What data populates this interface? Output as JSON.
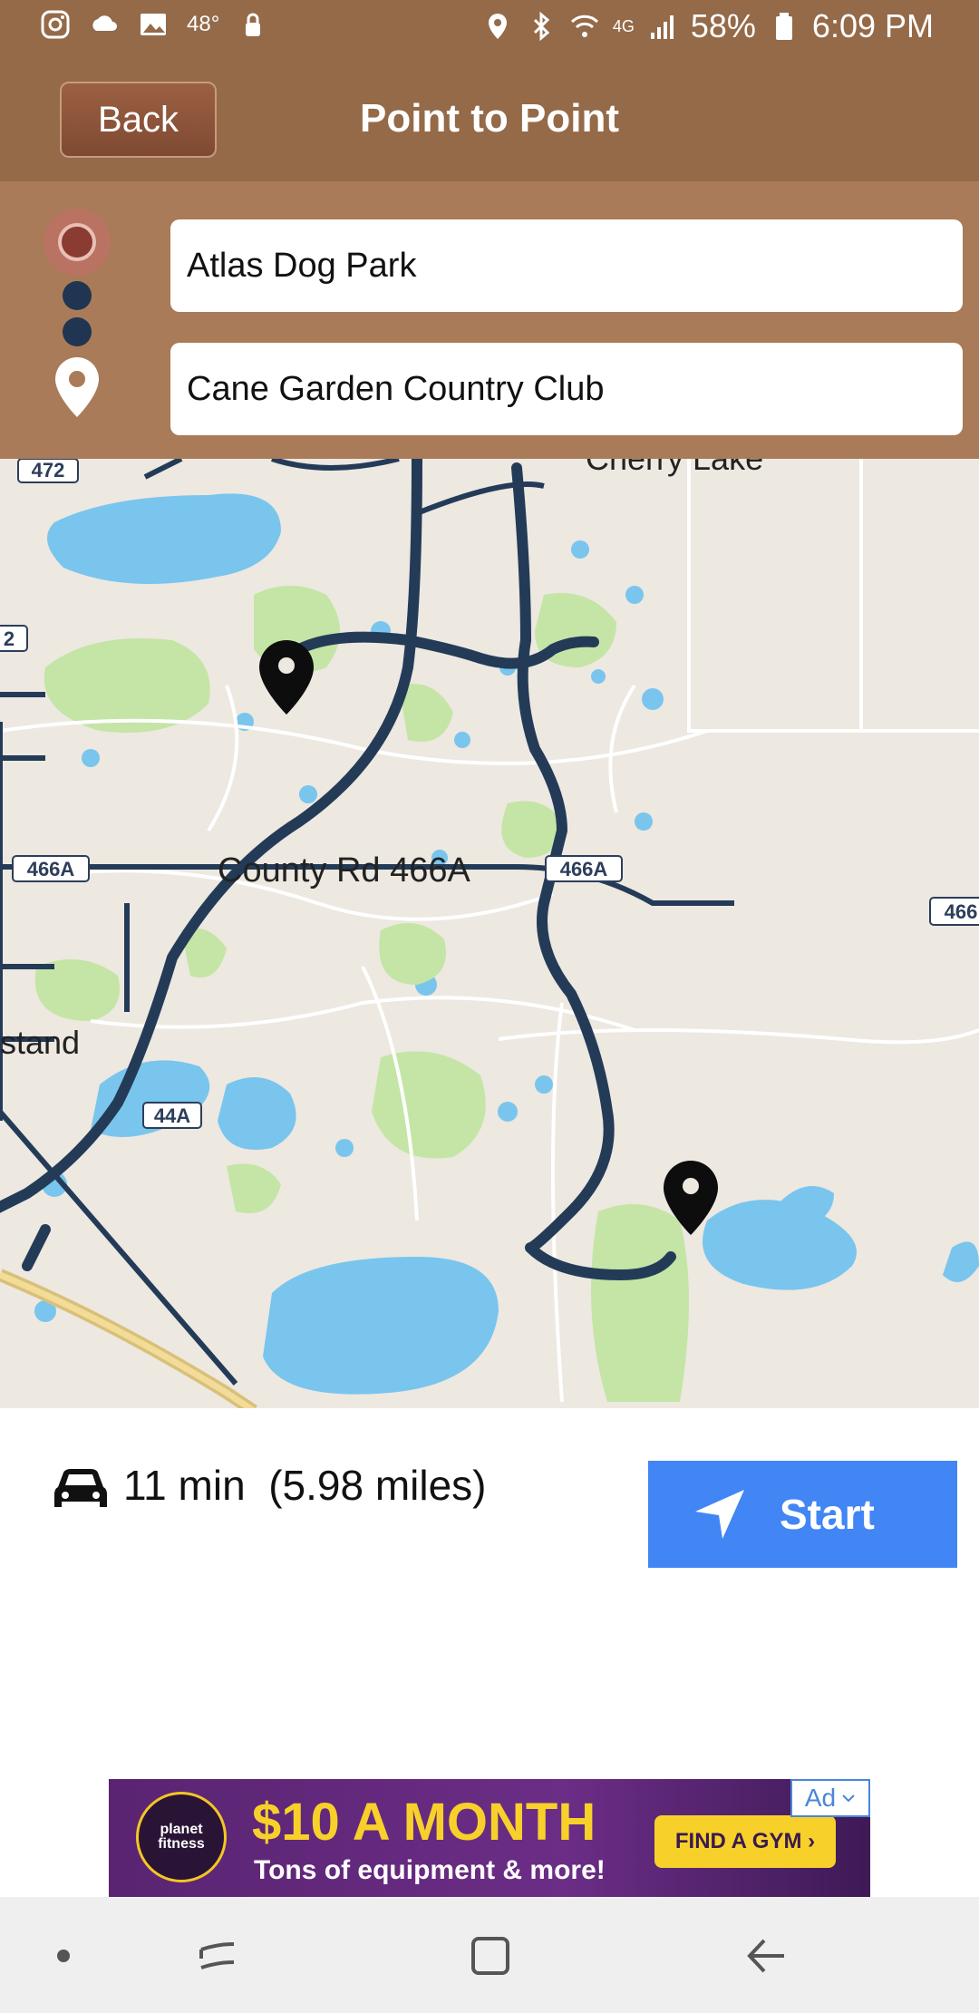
{
  "status_bar": {
    "temperature": "48°",
    "network": "4G",
    "battery": "58%",
    "time": "6:09 PM"
  },
  "header": {
    "back_label": "Back",
    "title": "Point to Point"
  },
  "route": {
    "origin": "Atlas Dog Park",
    "destination": "Cane Garden Country Club"
  },
  "map": {
    "labels": {
      "cherry_lake": "Cherry Lake",
      "county_rd": "County Rd 466A",
      "stand": "stand",
      "shield_472": "472",
      "shield_466a_left": "466A",
      "shield_466a_mid": "466A",
      "shield_466_right": "466",
      "shield_2": "2",
      "shield_44a": "44A"
    },
    "colors": {
      "land": "#ede8e0",
      "water": "#79c5ee",
      "park": "#c4e5a6",
      "route": "#243b58"
    }
  },
  "trip": {
    "duration": "11 min  (5.98 miles)",
    "start_label": "Start"
  },
  "ad": {
    "badge": "Ad",
    "logo_text": "planet fitness",
    "headline": "$10 A MONTH",
    "subtext": "Tons of equipment & more!",
    "cta": "FIND A GYM ›"
  }
}
